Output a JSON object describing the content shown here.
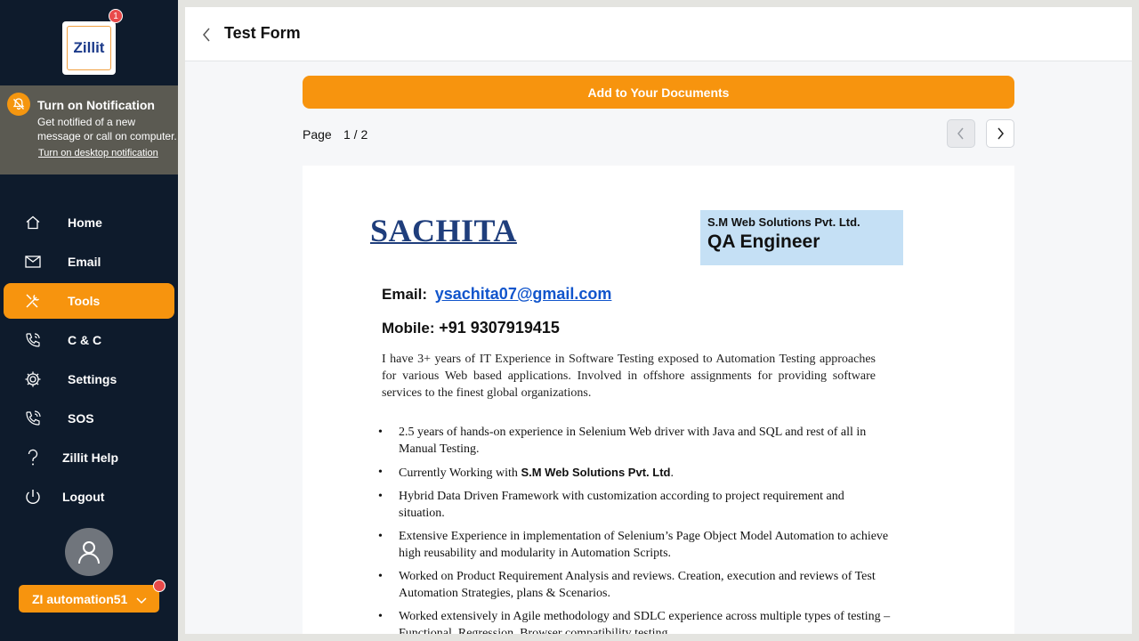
{
  "app": {
    "logo_text": "Zillit",
    "logo_badge": "1",
    "brand_color": "#f7940e"
  },
  "notification": {
    "title": "Turn on Notification",
    "text": "Get notified of a new message or call on computer.",
    "link": "Turn on desktop notification"
  },
  "sidebar": {
    "items": [
      {
        "label": "Home",
        "icon": "home-icon"
      },
      {
        "label": "Email",
        "icon": "mail-icon"
      },
      {
        "label": "Tools",
        "icon": "tools-icon",
        "active": true
      },
      {
        "label": "C & C",
        "icon": "phone-icon"
      },
      {
        "label": "Settings",
        "icon": "gear-icon"
      },
      {
        "label": "SOS",
        "icon": "sos-phone-icon"
      },
      {
        "label": "Zillit Help",
        "icon": "help-icon"
      },
      {
        "label": "Logout",
        "icon": "power-icon"
      }
    ],
    "user_label": "ZI automation51"
  },
  "header": {
    "title": "Test Form"
  },
  "toolbar": {
    "add_label": "Add to Your Documents",
    "page_label": "Page",
    "page_value": "1 / 2"
  },
  "document": {
    "name": "SACHITA",
    "company": "S.M Web Solutions Pvt. Ltd.",
    "role": "QA Engineer",
    "email_label": "Email:",
    "email_value": "ysachita07@gmail.com",
    "mobile_label": "Mobile:",
    "mobile_value": "+91 9307919415",
    "summary": "I have 3+ years of IT Experience in Software Testing exposed to Automation Testing approaches for various Web based applications. Involved in offshore assignments for providing software services to the finest global organizations.",
    "bullets": [
      "2.5 years of hands-on experience in Selenium Web driver with Java and SQL and rest of all in Manual Testing.",
      "Currently Working with",
      "Hybrid Data Driven Framework with customization according to project requirement and situation.",
      "Extensive Experience in implementation of Selenium’s Page Object Model Automation to achieve high reusability and modularity in Automation Scripts.",
      "Worked on Product Requirement Analysis and reviews. Creation, execution and reviews of Test Automation Strategies, plans & Scenarios.",
      "Worked extensively in Agile methodology and SDLC experience across multiple types of testing – Functional, Regression, Browser compatibility testing."
    ],
    "bullet2_company": "S.M Web Solutions Pvt. Ltd",
    "bullet2_suffix": "."
  }
}
